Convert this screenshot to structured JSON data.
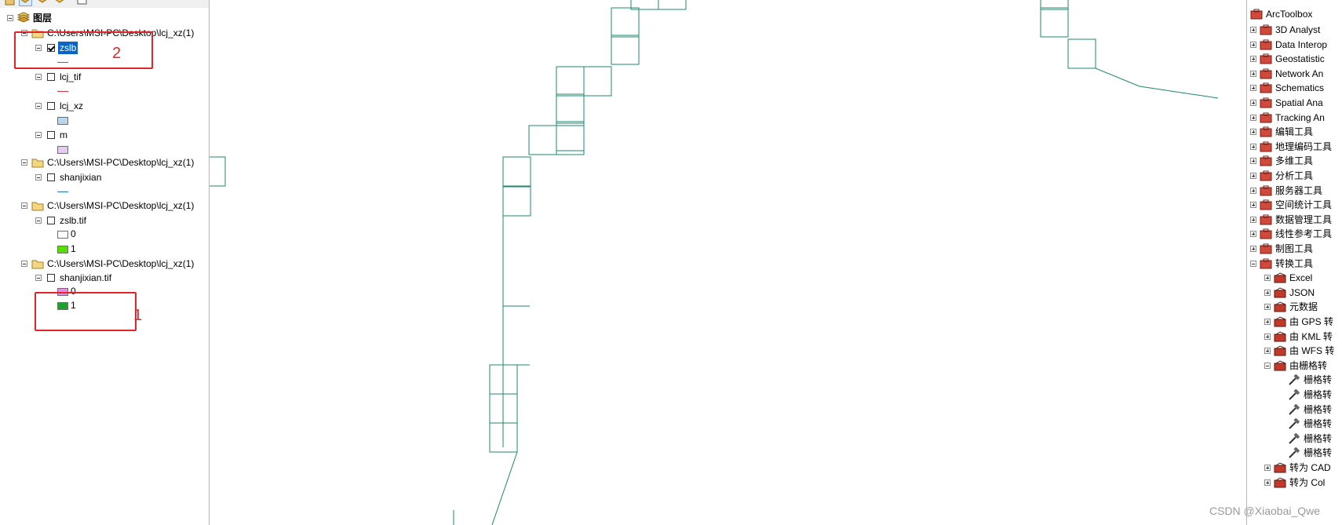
{
  "toc": {
    "root_label": "图层",
    "items": [
      {
        "type": "group",
        "label": "C:\\Users\\MSI-PC\\Desktop\\lcj_xz(1)"
      },
      {
        "type": "layer",
        "label": "zslb",
        "checked": true,
        "selected": true
      },
      {
        "type": "layer",
        "label": "lcj_tif",
        "checked": false
      },
      {
        "type": "layer",
        "label": "lcj_xz",
        "checked": false
      },
      {
        "type": "layer",
        "label": "m",
        "checked": false
      },
      {
        "type": "group",
        "label": "C:\\Users\\MSI-PC\\Desktop\\lcj_xz(1)"
      },
      {
        "type": "layer",
        "label": "shanjixian",
        "checked": false
      },
      {
        "type": "group",
        "label": "C:\\Users\\MSI-PC\\Desktop\\lcj_xz(1)"
      },
      {
        "type": "layer",
        "label": "zslb.tif",
        "checked": false
      },
      {
        "type": "legend",
        "label": "0",
        "color": "#ffffff"
      },
      {
        "type": "legend",
        "label": "1",
        "color": "#55e000"
      },
      {
        "type": "group",
        "label": "C:\\Users\\MSI-PC\\Desktop\\lcj_xz(1)"
      },
      {
        "type": "layer",
        "label": "shanjixian.tif",
        "checked": false
      },
      {
        "type": "legend",
        "label": "0",
        "color": "#e58be6"
      },
      {
        "type": "legend",
        "label": "1",
        "color": "#1ea02c"
      }
    ],
    "symbols": {
      "zslb_line_color": "#1f7fbf",
      "lcj_tif_line_color": "#d9333d",
      "lcj_xz_fill": "#bcd6ef",
      "m_fill": "#e3cdf0",
      "shanjixian_line_color": "#1f7fbf"
    },
    "annotations": [
      {
        "number": "2"
      },
      {
        "number": "1"
      }
    ],
    "annotation_color": "#e5242a"
  },
  "map": {
    "line_color": "#1b8a6b"
  },
  "toolbox": {
    "title": "ArcToolbox",
    "toolsets": [
      "3D Analyst",
      "Data Interop",
      "Geostatistic",
      "Network An",
      "Schematics",
      "Spatial Ana",
      "Tracking An",
      "编辑工具",
      "地理编码工具",
      "多维工具",
      "分析工具",
      "服务器工具",
      "空间统计工具",
      "数据管理工具",
      "线性参考工具",
      "制图工具",
      "转换工具"
    ],
    "conversion_children": [
      "Excel",
      "JSON",
      "元数据",
      "由 GPS 转",
      "由 KML 转",
      "由 WFS 转",
      "由栅格转"
    ],
    "raster_tools": [
      "栅格转",
      "栅格转",
      "栅格转",
      "栅格转",
      "栅格转",
      "栅格转"
    ],
    "tail_items": [
      "转为 CAD",
      "转为 Col"
    ]
  },
  "watermark": "CSDN @Xiaobai_Qwe"
}
